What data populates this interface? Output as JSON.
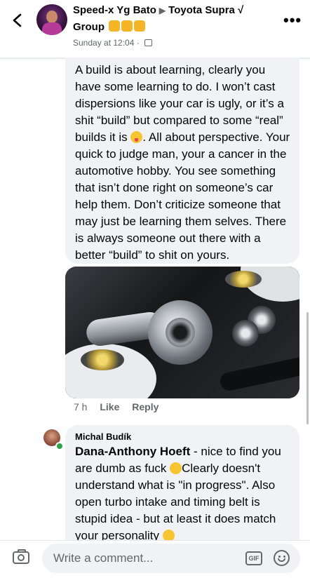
{
  "header": {
    "author": "Speed-x Yg Bato",
    "arrow": "▶",
    "group_name_part1": "Toyota Supra √",
    "group_name_part2": "Group",
    "timestamp": "Sunday at 12:04",
    "separator": "·",
    "more_label": "•••"
  },
  "post": {
    "text_part1": "A build is about learning, clearly you have some learning to do. I won’t cast dispersions like your car is ugly, or it’s a shit “build” but compared to some “real” builds it is ",
    "text_part2": ". All about perspective. Your quick to judge man, your a cancer in the automotive hobby. You see something that isn’t done right on someone’s car help them. Don’t criticize someone that may just be learning them selves. There is always someone out there with a better “build” to shit on yours.",
    "photo_alt": "engine-bay-turbo-photo",
    "time_ago": "7 h",
    "like_label": "Like",
    "reply_label": "Reply"
  },
  "reply": {
    "author": "Michal Budík",
    "tagged_name": "Dana-Anthony Hoeft",
    "text_part1": " - nice to find you are dumb as fuck ",
    "text_part2": "Clearly doesn't understand what is \"in progress\". Also open turbo intake and timing belt is stupid idea - but at least it does match your personality "
  },
  "composer": {
    "placeholder": "Write a comment...",
    "gif_label": "GIF"
  },
  "colors": {
    "bubble": "#f0f2f5",
    "secondary_text": "#65676b",
    "online": "#31a24c"
  }
}
